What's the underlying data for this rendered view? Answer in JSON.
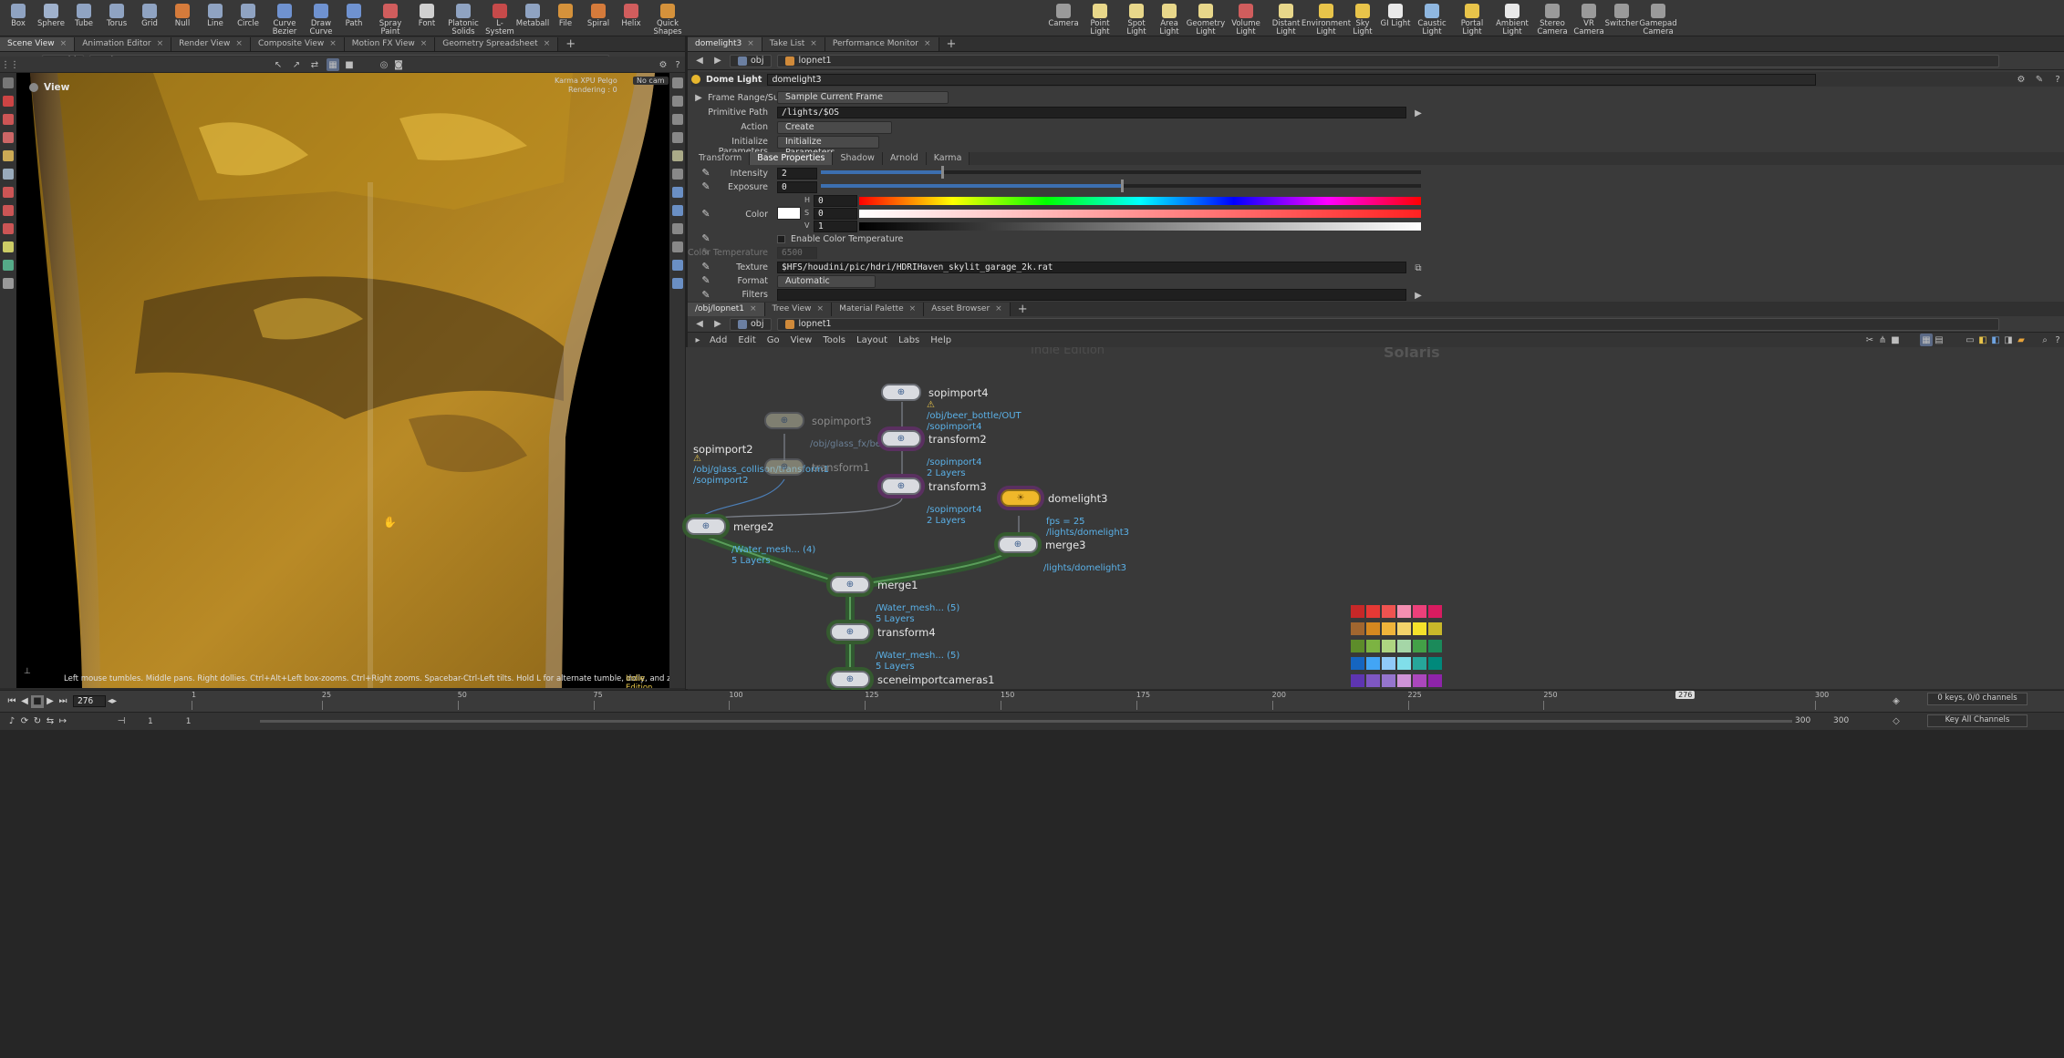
{
  "shelf": {
    "left_tools": [
      {
        "label": "Box",
        "icon": "box-icon",
        "color": "#8fa3c2"
      },
      {
        "label": "Sphere",
        "icon": "sphere-icon",
        "color": "#9fb1cc"
      },
      {
        "label": "Tube",
        "icon": "tube-icon",
        "color": "#8fa3c2"
      },
      {
        "label": "Torus",
        "icon": "torus-icon",
        "color": "#8fa3c2"
      },
      {
        "label": "Grid",
        "icon": "grid-icon",
        "color": "#8fa3c2"
      },
      {
        "label": "Null",
        "icon": "null-icon",
        "color": "#d57b3b"
      },
      {
        "label": "Line",
        "icon": "line-icon",
        "color": "#8fa3c2"
      },
      {
        "label": "Circle",
        "icon": "circle-icon",
        "color": "#8fa3c2"
      },
      {
        "label": "Curve Bezier",
        "icon": "curve-bezier-icon",
        "color": "#6f92d0"
      },
      {
        "label": "Draw Curve",
        "icon": "draw-curve-icon",
        "color": "#6f92d0"
      },
      {
        "label": "Path",
        "icon": "path-icon",
        "color": "#6f92d0"
      },
      {
        "label": "Spray Paint",
        "icon": "spray-paint-icon",
        "color": "#d05d5d"
      },
      {
        "label": "Font",
        "icon": "font-icon",
        "color": "#d0d0d0"
      },
      {
        "label": "Platonic Solids",
        "icon": "platonic-solids-icon",
        "color": "#8fa3c2"
      },
      {
        "label": "L-System",
        "icon": "l-system-icon",
        "color": "#c64a4a"
      },
      {
        "label": "Metaball",
        "icon": "metaball-icon",
        "color": "#8fa3c2"
      },
      {
        "label": "File",
        "icon": "file-icon",
        "color": "#d5923b"
      },
      {
        "label": "Spiral",
        "icon": "spiral-icon",
        "color": "#d57b3b"
      },
      {
        "label": "Helix",
        "icon": "helix-icon",
        "color": "#d05d5d"
      },
      {
        "label": "Quick Shapes",
        "icon": "quick-shapes-icon",
        "color": "#d5923b"
      }
    ],
    "right_tools": [
      {
        "label": "Camera",
        "icon": "camera-icon",
        "color": "#9a9a9a"
      },
      {
        "label": "Point Light",
        "icon": "point-light-icon",
        "color": "#e8d78a"
      },
      {
        "label": "Spot Light",
        "icon": "spot-light-icon",
        "color": "#e8d78a"
      },
      {
        "label": "Area Light",
        "icon": "area-light-icon",
        "color": "#e8d78a"
      },
      {
        "label": "Geometry Light",
        "icon": "geometry-light-icon",
        "color": "#e8d78a"
      },
      {
        "label": "Volume Light",
        "icon": "volume-light-icon",
        "color": "#d05d5d"
      },
      {
        "label": "Distant Light",
        "icon": "distant-light-icon",
        "color": "#e8d78a"
      },
      {
        "label": "Environment Light",
        "icon": "environment-light-icon",
        "color": "#e8c44a"
      },
      {
        "label": "Sky Light",
        "icon": "sky-light-icon",
        "color": "#e8c44a"
      },
      {
        "label": "GI Light",
        "icon": "gi-light-icon",
        "color": "#e8e8e8"
      },
      {
        "label": "Caustic Light",
        "icon": "caustic-light-icon",
        "color": "#8fb7e0"
      },
      {
        "label": "Portal Light",
        "icon": "portal-light-icon",
        "color": "#e8c44a"
      },
      {
        "label": "Ambient Light",
        "icon": "ambient-light-icon",
        "color": "#e8e8e8"
      },
      {
        "label": "Stereo Camera",
        "icon": "stereo-camera-icon",
        "color": "#9a9a9a"
      },
      {
        "label": "VR Camera",
        "icon": "vr-camera-icon",
        "color": "#9a9a9a"
      },
      {
        "label": "Switcher",
        "icon": "switcher-icon",
        "color": "#9a9a9a"
      },
      {
        "label": "Gamepad Camera",
        "icon": "gamepad-camera-icon",
        "color": "#9a9a9a"
      }
    ]
  },
  "left_pane": {
    "tabs": [
      "Scene View",
      "Animation Editor",
      "Render View",
      "Composite View",
      "Motion FX View",
      "Geometry Spreadsheet"
    ],
    "path": {
      "root": "obj",
      "node": "lopnet1"
    },
    "viewport": {
      "label": "View",
      "hud_lines": [
        "Karma XPU Pelgo",
        "Rendering : 0",
        "",
        ""
      ],
      "hud_camera": "No cam",
      "status": "Left mouse tumbles. Middle pans. Right dollies. Ctrl+Alt+Left box-zooms. Ctrl+Right zooms. Spacebar-Ctrl-Left tilts. Hold L for alternate tumble, dolly, and zoom. M or Alt+M for First Person Navigation.",
      "edition": "Indie Edition"
    }
  },
  "param_pane": {
    "tabs": [
      "domelight3",
      "Take List",
      "Performance Monitor"
    ],
    "path": {
      "root": "obj",
      "node": "lopnet1"
    },
    "node_type": "Dome Light",
    "node_name": "domelight3",
    "frame_range": {
      "label": "Frame Range/Subframes",
      "value": "Sample Current Frame"
    },
    "primitive_path": {
      "label": "Primitive Path",
      "value": "/lights/$OS"
    },
    "action": {
      "label": "Action",
      "value": "Create"
    },
    "init_params": {
      "label": "Initialize Parameters",
      "value": "Initialize Parameters"
    },
    "subtabs": [
      "Transform",
      "Base Properties",
      "Shadow",
      "Arnold",
      "Karma"
    ],
    "active_subtab": "Base Properties",
    "intensity": {
      "label": "Intensity",
      "value": "2",
      "fraction": 0.2
    },
    "exposure": {
      "label": "Exposure",
      "value": "0",
      "fraction": 0.5
    },
    "color": {
      "label": "Color",
      "h_label": "H",
      "h": "0",
      "s_label": "S",
      "s": "0",
      "v_label": "V",
      "v": "1",
      "swatch": "#ffffff"
    },
    "enable_color_temp": "Enable Color Temperature",
    "color_temp": {
      "label": "Color Temperature",
      "value": "6500"
    },
    "texture": {
      "label": "Texture",
      "value": "$HFS/houdini/pic/hdri/HDRIHaven_skylit_garage_2k.rat"
    },
    "format": {
      "label": "Format",
      "value": "Automatic"
    },
    "filters": {
      "label": "Filters",
      "value": ""
    }
  },
  "network_pane": {
    "tabs": [
      "/obj/lopnet1",
      "Tree View",
      "Material Palette",
      "Asset Browser"
    ],
    "path": {
      "root": "obj",
      "node": "lopnet1"
    },
    "menu": [
      "Add",
      "Edit",
      "Go",
      "View",
      "Tools",
      "Layout",
      "Labs",
      "Help"
    ],
    "watermark_edition": "Indie Edition",
    "context": "Solaris",
    "nodes": [
      {
        "name": "sopimport4",
        "info": [
          "/obj/beer_bottle/OUT",
          "/sopimport4"
        ],
        "bypass": false,
        "warn": true
      },
      {
        "name": "sopimport3",
        "info": [
          "/obj/glass_fx/bend1"
        ],
        "bypass": true,
        "warn": false
      },
      {
        "name": "transform2",
        "info": [
          "/sopimport4",
          "2 Layers"
        ],
        "bypass": false,
        "warn": false
      },
      {
        "name": "sopimport2",
        "info": [
          "/obj/glass_collison/transform1",
          "/sopimport2"
        ],
        "bypass": false,
        "warn": true
      },
      {
        "name": "transform1",
        "info": [],
        "bypass": true,
        "warn": false
      },
      {
        "name": "transform3",
        "info": [
          "/sopimport4",
          "2 Layers"
        ],
        "bypass": false,
        "warn": false
      },
      {
        "name": "domelight3",
        "info": [
          "fps = 25",
          "/lights/domelight3"
        ],
        "bypass": false,
        "warn": false
      },
      {
        "name": "merge2",
        "info": [
          "/Water_mesh... (4)",
          "5 Layers"
        ],
        "bypass": false,
        "warn": false
      },
      {
        "name": "merge3",
        "info": [
          "/lights/domelight3"
        ],
        "bypass": false,
        "warn": false
      },
      {
        "name": "merge1",
        "info": [
          "/Water_mesh... (5)",
          "5 Layers"
        ],
        "bypass": false,
        "warn": false
      },
      {
        "name": "transform4",
        "info": [
          "/Water_mesh... (5)",
          "5 Layers"
        ],
        "bypass": false,
        "warn": false
      },
      {
        "name": "sceneimportcameras1",
        "info": [],
        "bypass": false,
        "warn": false
      }
    ],
    "palette": [
      "#c62828",
      "#e53935",
      "#ef5350",
      "#f48fb1",
      "#ec407a",
      "#d81b60",
      "#a1662f",
      "#d4881f",
      "#f0b43a",
      "#f3d36a",
      "#f5e12a",
      "#c9b82a",
      "#5d8c2a",
      "#7cb342",
      "#aed581",
      "#a5d6a7",
      "#43a047",
      "#1b8a5a",
      "#1565c0",
      "#42a5f5",
      "#90caf9",
      "#80deea",
      "#26a69a",
      "#00897b",
      "#5e35b1",
      "#7e57c2",
      "#9575cd",
      "#ce93d8",
      "#ab47bc",
      "#8e24aa",
      "#111111",
      "#3a3a3a",
      "#777777",
      "#a6a6a6",
      "#d6d6d6",
      "#ffffff"
    ]
  },
  "timeline": {
    "current_frame": "276",
    "ticks": [
      "1",
      "25",
      "50",
      "75",
      "100",
      "125",
      "150",
      "175",
      "200",
      "225",
      "250",
      "300"
    ],
    "marker": "276",
    "range_start": "1",
    "range_start2": "1",
    "range_end": "300",
    "range_end2": "300",
    "keys": "0 keys, 0/0 channels",
    "key_all": "Key All Channels"
  }
}
